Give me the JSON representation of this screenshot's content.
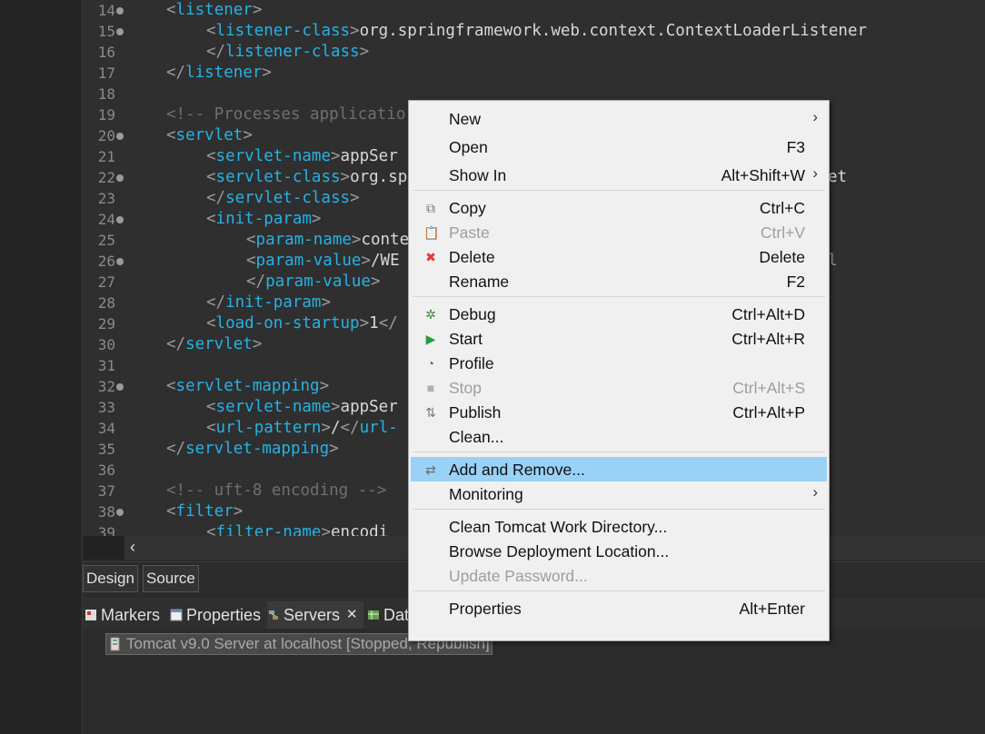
{
  "editor": {
    "lines": [
      {
        "n": "14",
        "fold": true,
        "indent": 1,
        "parts": [
          [
            "p",
            "<"
          ],
          [
            "t",
            "listener"
          ],
          [
            "p",
            ">"
          ]
        ]
      },
      {
        "n": "15",
        "fold": true,
        "indent": 2,
        "parts": [
          [
            "p",
            "<"
          ],
          [
            "t",
            "listener-class"
          ],
          [
            "p",
            ">"
          ],
          [
            "x",
            "org.springframework.web.context.ContextLoaderListener"
          ]
        ]
      },
      {
        "n": "16",
        "fold": false,
        "indent": 2,
        "parts": [
          [
            "p",
            "</"
          ],
          [
            "t",
            "listener-class"
          ],
          [
            "p",
            ">"
          ]
        ]
      },
      {
        "n": "17",
        "fold": false,
        "indent": 1,
        "parts": [
          [
            "p",
            "</"
          ],
          [
            "t",
            "listener"
          ],
          [
            "p",
            ">"
          ]
        ]
      },
      {
        "n": "18",
        "fold": false,
        "indent": 0,
        "parts": []
      },
      {
        "n": "19",
        "fold": false,
        "indent": 1,
        "parts": [
          [
            "c",
            "<!-- Processes applicatio"
          ]
        ]
      },
      {
        "n": "20",
        "fold": true,
        "indent": 1,
        "parts": [
          [
            "p",
            "<"
          ],
          [
            "t",
            "servlet"
          ],
          [
            "p",
            ">"
          ]
        ]
      },
      {
        "n": "21",
        "fold": false,
        "indent": 2,
        "parts": [
          [
            "p",
            "<"
          ],
          [
            "t",
            "servlet-name"
          ],
          [
            "p",
            ">"
          ],
          [
            "x",
            "appSer"
          ]
        ]
      },
      {
        "n": "22",
        "fold": true,
        "indent": 2,
        "parts": [
          [
            "p",
            "<"
          ],
          [
            "t",
            "servlet-class"
          ],
          [
            "p",
            ">"
          ],
          [
            "x",
            "org.sp"
          ]
        ]
      },
      {
        "n": "23",
        "fold": false,
        "indent": 2,
        "parts": [
          [
            "p",
            "</"
          ],
          [
            "t",
            "servlet-class"
          ],
          [
            "p",
            ">"
          ]
        ]
      },
      {
        "n": "24",
        "fold": true,
        "indent": 2,
        "parts": [
          [
            "p",
            "<"
          ],
          [
            "t",
            "init-param"
          ],
          [
            "p",
            ">"
          ]
        ]
      },
      {
        "n": "25",
        "fold": false,
        "indent": 3,
        "parts": [
          [
            "p",
            "<"
          ],
          [
            "t",
            "param-name"
          ],
          [
            "p",
            ">"
          ],
          [
            "x",
            "conte"
          ]
        ]
      },
      {
        "n": "26",
        "fold": true,
        "indent": 3,
        "parts": [
          [
            "p",
            "<"
          ],
          [
            "t",
            "param-value"
          ],
          [
            "p",
            ">"
          ],
          [
            "x",
            "/WE"
          ]
        ]
      },
      {
        "n": "27",
        "fold": false,
        "indent": 3,
        "parts": [
          [
            "p",
            "</"
          ],
          [
            "t",
            "param-value"
          ],
          [
            "p",
            ">"
          ]
        ]
      },
      {
        "n": "28",
        "fold": false,
        "indent": 2,
        "parts": [
          [
            "p",
            "</"
          ],
          [
            "t",
            "init-param"
          ],
          [
            "p",
            ">"
          ]
        ]
      },
      {
        "n": "29",
        "fold": false,
        "indent": 2,
        "parts": [
          [
            "p",
            "<"
          ],
          [
            "t",
            "load-on-startup"
          ],
          [
            "p",
            ">"
          ],
          [
            "x",
            "1"
          ],
          [
            "p",
            "</"
          ]
        ]
      },
      {
        "n": "30",
        "fold": false,
        "indent": 1,
        "parts": [
          [
            "p",
            "</"
          ],
          [
            "t",
            "servlet"
          ],
          [
            "p",
            ">"
          ]
        ]
      },
      {
        "n": "31",
        "fold": false,
        "indent": 0,
        "parts": []
      },
      {
        "n": "32",
        "fold": true,
        "indent": 1,
        "parts": [
          [
            "p",
            "<"
          ],
          [
            "t",
            "servlet-mapping"
          ],
          [
            "p",
            ">"
          ]
        ]
      },
      {
        "n": "33",
        "fold": false,
        "indent": 2,
        "parts": [
          [
            "p",
            "<"
          ],
          [
            "t",
            "servlet-name"
          ],
          [
            "p",
            ">"
          ],
          [
            "x",
            "appSer"
          ]
        ]
      },
      {
        "n": "34",
        "fold": false,
        "indent": 2,
        "parts": [
          [
            "p",
            "<"
          ],
          [
            "t",
            "url-pattern"
          ],
          [
            "p",
            ">"
          ],
          [
            "x",
            "/"
          ],
          [
            "p",
            "</"
          ],
          [
            "t",
            "url-"
          ]
        ]
      },
      {
        "n": "35",
        "fold": false,
        "indent": 1,
        "parts": [
          [
            "p",
            "</"
          ],
          [
            "t",
            "servlet-mapping"
          ],
          [
            "p",
            ">"
          ]
        ]
      },
      {
        "n": "36",
        "fold": false,
        "indent": 0,
        "parts": []
      },
      {
        "n": "37",
        "fold": false,
        "indent": 1,
        "parts": [
          [
            "c",
            "<!-- uft-8 encoding -->"
          ]
        ]
      },
      {
        "n": "38",
        "fold": true,
        "indent": 1,
        "parts": [
          [
            "p",
            "<"
          ],
          [
            "t",
            "filter"
          ],
          [
            "p",
            ">"
          ]
        ]
      },
      {
        "n": "39",
        "fold": false,
        "indent": 2,
        "parts": [
          [
            "p",
            "<"
          ],
          [
            "t",
            "filter-name"
          ],
          [
            "p",
            ">"
          ],
          [
            "x",
            "encodi"
          ]
        ]
      }
    ],
    "right_fragments": [
      {
        "text": "et",
        "line": 22
      },
      {
        "text": "l",
        "line": 26
      }
    ]
  },
  "editor_tabs": [
    "Design",
    "Source"
  ],
  "view_tabs": [
    {
      "label": "Markers",
      "icon": "markers-icon"
    },
    {
      "label": "Properties",
      "icon": "properties-icon"
    },
    {
      "label": "Servers",
      "icon": "servers-icon",
      "close": "✕"
    },
    {
      "label": "Dat",
      "icon": "data-source-icon"
    }
  ],
  "server_entry": {
    "label": "Tomcat v9.0 Server at localhost  [Stopped, Republish]",
    "icon": "server-icon"
  },
  "context_menu": {
    "groups": [
      [
        {
          "label": "New",
          "shortcut": "",
          "submenu": true
        },
        {
          "label": "Open",
          "shortcut": "F3"
        },
        {
          "label": "Show In",
          "shortcut": "Alt+Shift+W",
          "submenu": true
        }
      ],
      [
        {
          "label": "Copy",
          "shortcut": "Ctrl+C",
          "icon": "copy-icon",
          "glyph": "⧉"
        },
        {
          "label": "Paste",
          "shortcut": "Ctrl+V",
          "icon": "paste-icon",
          "glyph": "📋",
          "disabled": true
        },
        {
          "label": "Delete",
          "shortcut": "Delete",
          "icon": "delete-icon",
          "glyph": "✖",
          "color": "#e8343a"
        },
        {
          "label": "Rename",
          "shortcut": "F2"
        }
      ],
      [
        {
          "label": "Debug",
          "shortcut": "Ctrl+Alt+D",
          "icon": "debug-icon",
          "glyph": "✲",
          "color": "#3a8a3a"
        },
        {
          "label": "Start",
          "shortcut": "Ctrl+Alt+R",
          "icon": "start-icon",
          "glyph": "▶",
          "color": "#2e9a3e"
        },
        {
          "label": "Profile",
          "shortcut": "",
          "icon": "profile-icon",
          "glyph": "◔",
          "color": "#3b7d6b"
        },
        {
          "label": "Stop",
          "shortcut": "Ctrl+Alt+S",
          "icon": "stop-icon",
          "glyph": "■",
          "color": "#b0b0b0",
          "disabled": true
        },
        {
          "label": "Publish",
          "shortcut": "Ctrl+Alt+P",
          "icon": "publish-icon",
          "glyph": "⇅",
          "color": "#777"
        },
        {
          "label": "Clean...",
          "shortcut": ""
        }
      ],
      [
        {
          "label": "Add and Remove...",
          "shortcut": "",
          "icon": "add-remove-icon",
          "glyph": "⇄",
          "color": "#6a6a6a",
          "selected": true
        },
        {
          "label": "Monitoring",
          "shortcut": "",
          "submenu": true
        }
      ],
      [
        {
          "label": "Clean Tomcat Work Directory...",
          "shortcut": ""
        },
        {
          "label": "Browse Deployment Location...",
          "shortcut": ""
        },
        {
          "label": "Update Password...",
          "shortcut": "",
          "disabled": true
        }
      ],
      [
        {
          "label": "Properties",
          "shortcut": "Alt+Enter"
        }
      ]
    ],
    "submenu_arrow": "›"
  },
  "colors": {
    "tag": "#26b2e5",
    "selection": "#99d1f7",
    "background": "#2b2b2b"
  }
}
